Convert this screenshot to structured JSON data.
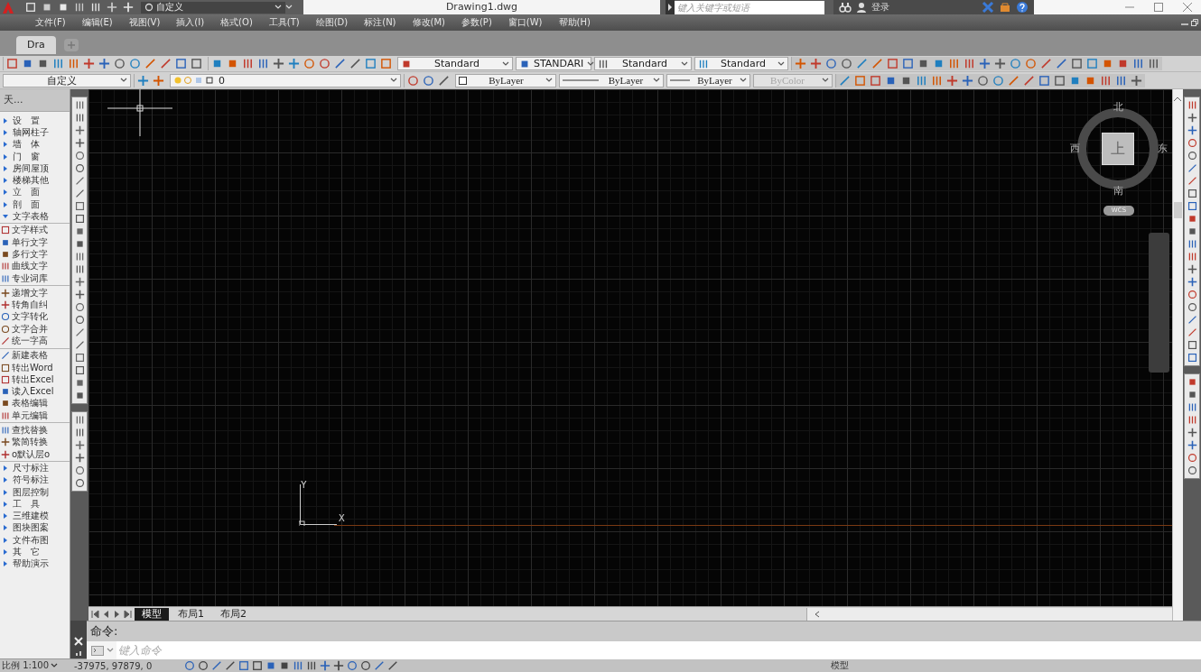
{
  "title_bar": {
    "workspace": "自定义",
    "title": "Drawing1.dwg",
    "search": {
      "placeholder": "键入关键字或短语"
    },
    "sign_in": "登录"
  },
  "menu": [
    "文件(F)",
    "编辑(E)",
    "视图(V)",
    "插入(I)",
    "格式(O)",
    "工具(T)",
    "绘图(D)",
    "标注(N)",
    "修改(M)",
    "参数(P)",
    "窗口(W)",
    "帮助(H)"
  ],
  "document_tabs": [
    {
      "label": "Dra",
      "selected": true
    }
  ],
  "toolbar": {
    "styles": [
      "Standard",
      "STANDARI",
      "Standard",
      "Standard"
    ],
    "workspace": "自定义",
    "layer": "0",
    "layer_color": "ByLayer",
    "linetype": "ByLayer",
    "lineweight": "ByLayer",
    "plot_style": "ByColor",
    "plot_style_disabled": true
  },
  "palette": {
    "title": "天...",
    "categories": [
      {
        "label": "设　置",
        "expanded": false
      },
      {
        "label": "轴网柱子",
        "expanded": false
      },
      {
        "label": "墙　体",
        "expanded": false
      },
      {
        "label": "门　窗",
        "expanded": false
      },
      {
        "label": "房间屋顶",
        "expanded": false
      },
      {
        "label": "楼梯其他",
        "expanded": false
      },
      {
        "label": "立　面",
        "expanded": false
      },
      {
        "label": "剖　面",
        "expanded": false
      },
      {
        "label": "文字表格",
        "expanded": true,
        "groups": [
          [
            "文字样式",
            "单行文字",
            "多行文字",
            "曲线文字",
            "专业词库"
          ],
          [
            "递增文字",
            "转角自纠",
            "文字转化",
            "文字合并",
            "统一字高"
          ],
          [
            "新建表格",
            "转出Word",
            "转出Excel",
            "读入Excel",
            "表格编辑",
            "单元编辑"
          ],
          [
            "查找替换",
            "繁简转换",
            "o默认层o"
          ]
        ]
      },
      {
        "label": "尺寸标注",
        "expanded": false
      },
      {
        "label": "符号标注",
        "expanded": false
      },
      {
        "label": "图层控制",
        "expanded": false
      },
      {
        "label": "工　具",
        "expanded": false
      },
      {
        "label": "三维建模",
        "expanded": false
      },
      {
        "label": "图块图案",
        "expanded": false
      },
      {
        "label": "文件布图",
        "expanded": false
      },
      {
        "label": "其　它",
        "expanded": false
      },
      {
        "label": "帮助演示",
        "expanded": false
      }
    ]
  },
  "canvas": {
    "compass": {
      "north": "北",
      "south": "南",
      "east": "东",
      "west": "西",
      "view": "上",
      "ucs": "WCS"
    },
    "ucs_axes": {
      "x": "X",
      "y": "Y"
    }
  },
  "layout_tabs": [
    {
      "label": "模型",
      "selected": true
    },
    {
      "label": "布局1",
      "selected": false
    },
    {
      "label": "布局2",
      "selected": false
    }
  ],
  "command_line": {
    "history": "命令:",
    "placeholder": "键入命令"
  },
  "status_bar": {
    "scale": "比例 1:100",
    "coordinates": "-37975, 97879, 0",
    "space": "模型"
  }
}
